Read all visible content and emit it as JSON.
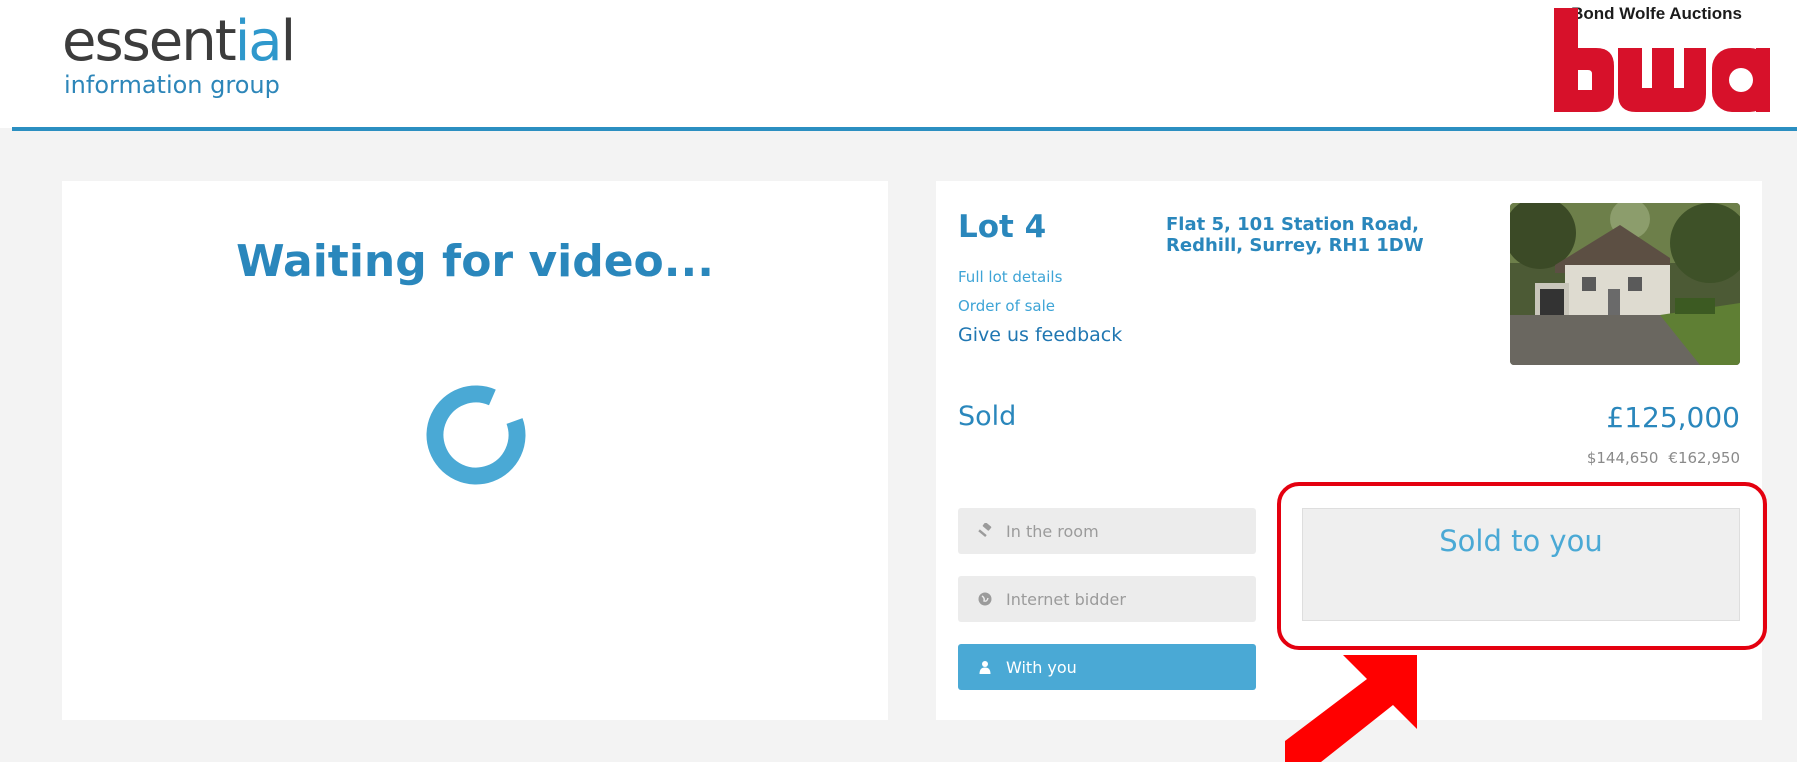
{
  "header": {
    "logo": {
      "word_main": "essent",
      "word_accent": "ia",
      "word_end": "l",
      "subtitle": "information group"
    },
    "partner_logo": {
      "title": "Bond Wolfe Auctions",
      "mark": "bwa"
    }
  },
  "video": {
    "waiting_text": "Waiting for video..."
  },
  "lot": {
    "title": "Lot 4",
    "address_line1": "Flat 5, 101 Station Road,",
    "address_line2": "Redhill, Surrey, RH1 1DW",
    "links": {
      "full_details": "Full lot details",
      "order_of_sale": "Order of sale",
      "feedback": "Give us feedback"
    },
    "status": "Sold",
    "price": "£125,000",
    "conversions": {
      "usd": "$144,650",
      "eur": "€162,950"
    },
    "bid_sources": [
      {
        "label": "In the room",
        "icon": "gavel-icon",
        "active": false
      },
      {
        "label": "Internet bidder",
        "icon": "globe-icon",
        "active": false
      },
      {
        "label": "With you",
        "icon": "user-icon",
        "active": true
      }
    ],
    "result_box": "Sold to you"
  },
  "colors": {
    "brand_blue": "#2a87bc",
    "accent_blue": "#4aa9d5",
    "annotation_red": "#e4000f",
    "bwa_red": "#d7112a"
  }
}
